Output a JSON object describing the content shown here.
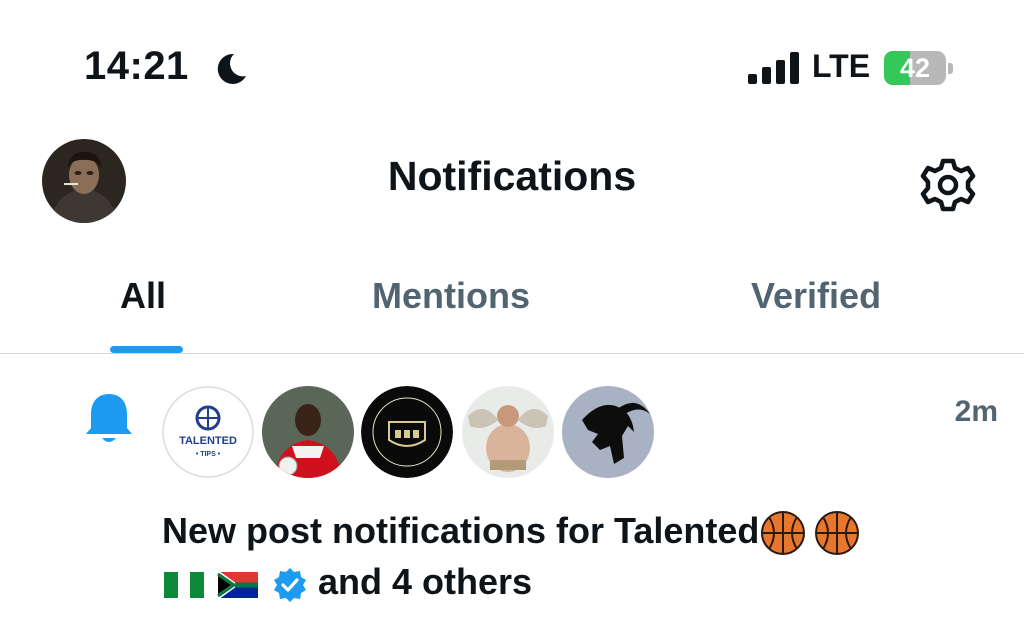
{
  "status_bar": {
    "time": "14:21",
    "network": "LTE",
    "battery_level": "42",
    "battery_fraction": 0.42
  },
  "header": {
    "title": "Notifications",
    "avatar_icon": "profile-avatar",
    "settings_icon": "gear-icon"
  },
  "tabs": [
    {
      "label": "All",
      "active": true
    },
    {
      "label": "Mentions",
      "active": false
    },
    {
      "label": "Verified",
      "active": false
    }
  ],
  "notification": {
    "icon": "bell-icon",
    "time": "2m",
    "avatars": [
      "talented-tips",
      "football-player",
      "crest-logo",
      "angel-figure",
      "goat-logo"
    ],
    "avatar_text": {
      "talented_tips_line1": "TALENTED",
      "talented_tips_line2": "• TIPS •"
    },
    "text_line1": "New post notifications for Talented",
    "text_line2": "and 4 others"
  },
  "colors": {
    "accent": "#1d9bf0",
    "text_primary": "#0f1419",
    "text_secondary": "#536471",
    "battery_green": "#34c759"
  }
}
